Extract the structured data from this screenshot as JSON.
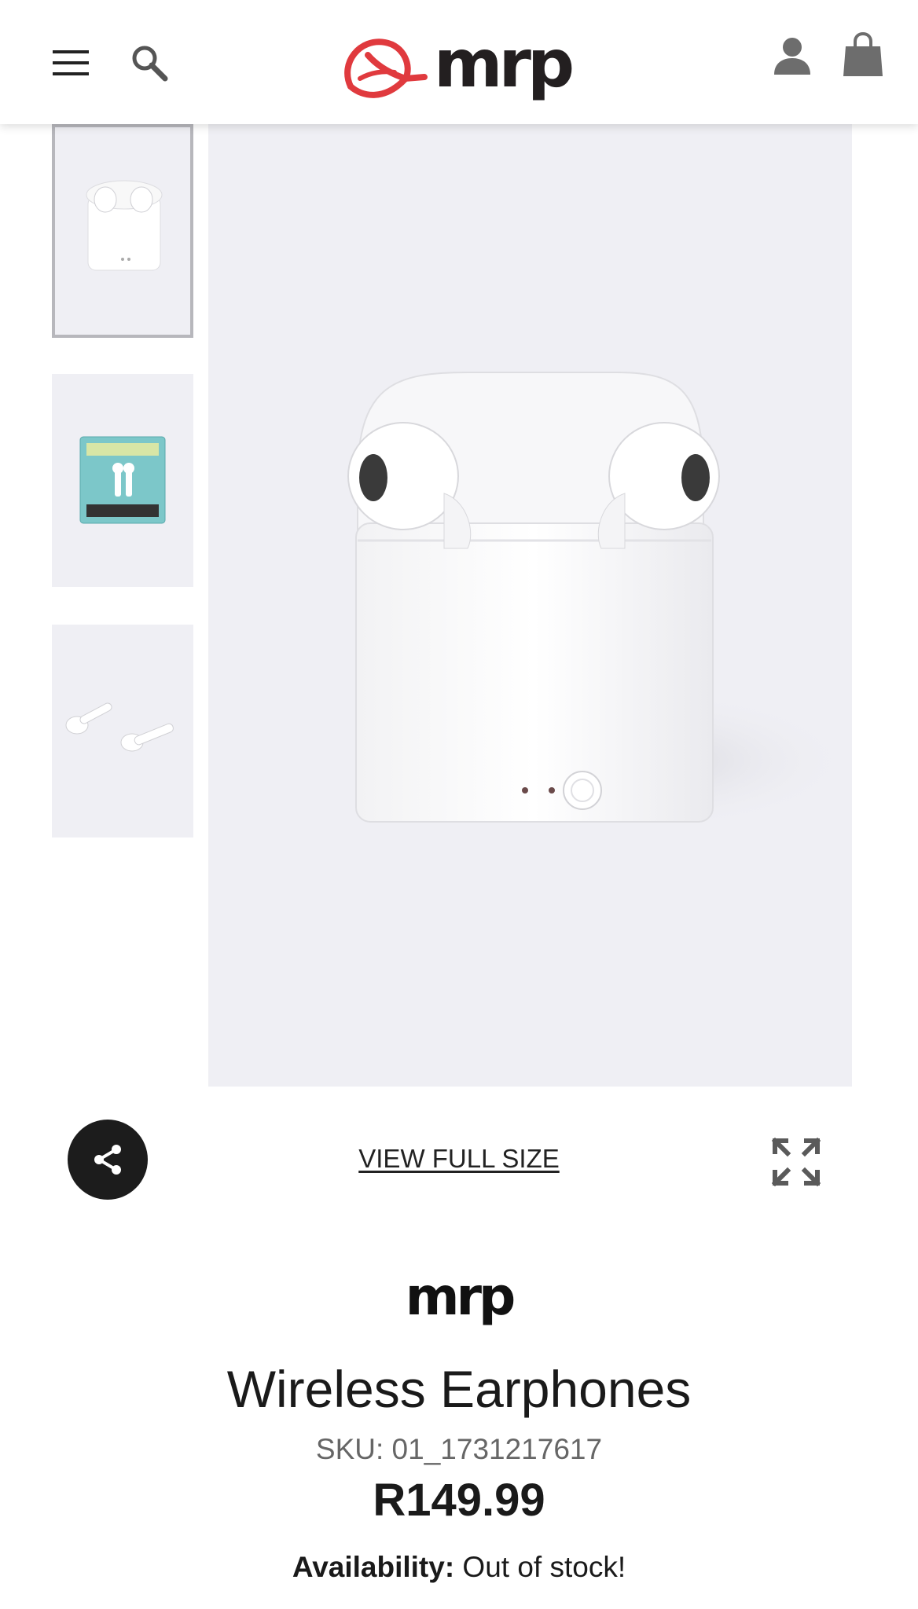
{
  "header": {
    "logo_text": "mrp",
    "icons": {
      "menu": "hamburger-menu-icon",
      "search": "search-icon",
      "account": "account-icon",
      "cart": "shopping-bag-icon"
    },
    "brand_color": "#e03a3e"
  },
  "gallery": {
    "thumbnails": [
      {
        "name": "earbuds-case-front",
        "active": true
      },
      {
        "name": "earbuds-packaging-box",
        "active": false
      },
      {
        "name": "earbuds-pair-side",
        "active": false
      }
    ],
    "main_image": "white wireless earbuds in charging case"
  },
  "controls": {
    "view_full_size_label": "VIEW FULL SIZE",
    "share_icon": "share-icon",
    "expand_icon": "expand-icon"
  },
  "product": {
    "brand": "mrp",
    "title": "Wireless Earphones",
    "sku": "SKU: 01_1731217617",
    "price": "R149.99",
    "availability_label": "Availability:",
    "availability_value": " Out of stock!"
  },
  "colors": {
    "image_background": "#efeff4",
    "share_button": "#1c1c1c",
    "icon_gray": "#6d6d6d",
    "active_thumb_border": "#b7b7bc"
  }
}
